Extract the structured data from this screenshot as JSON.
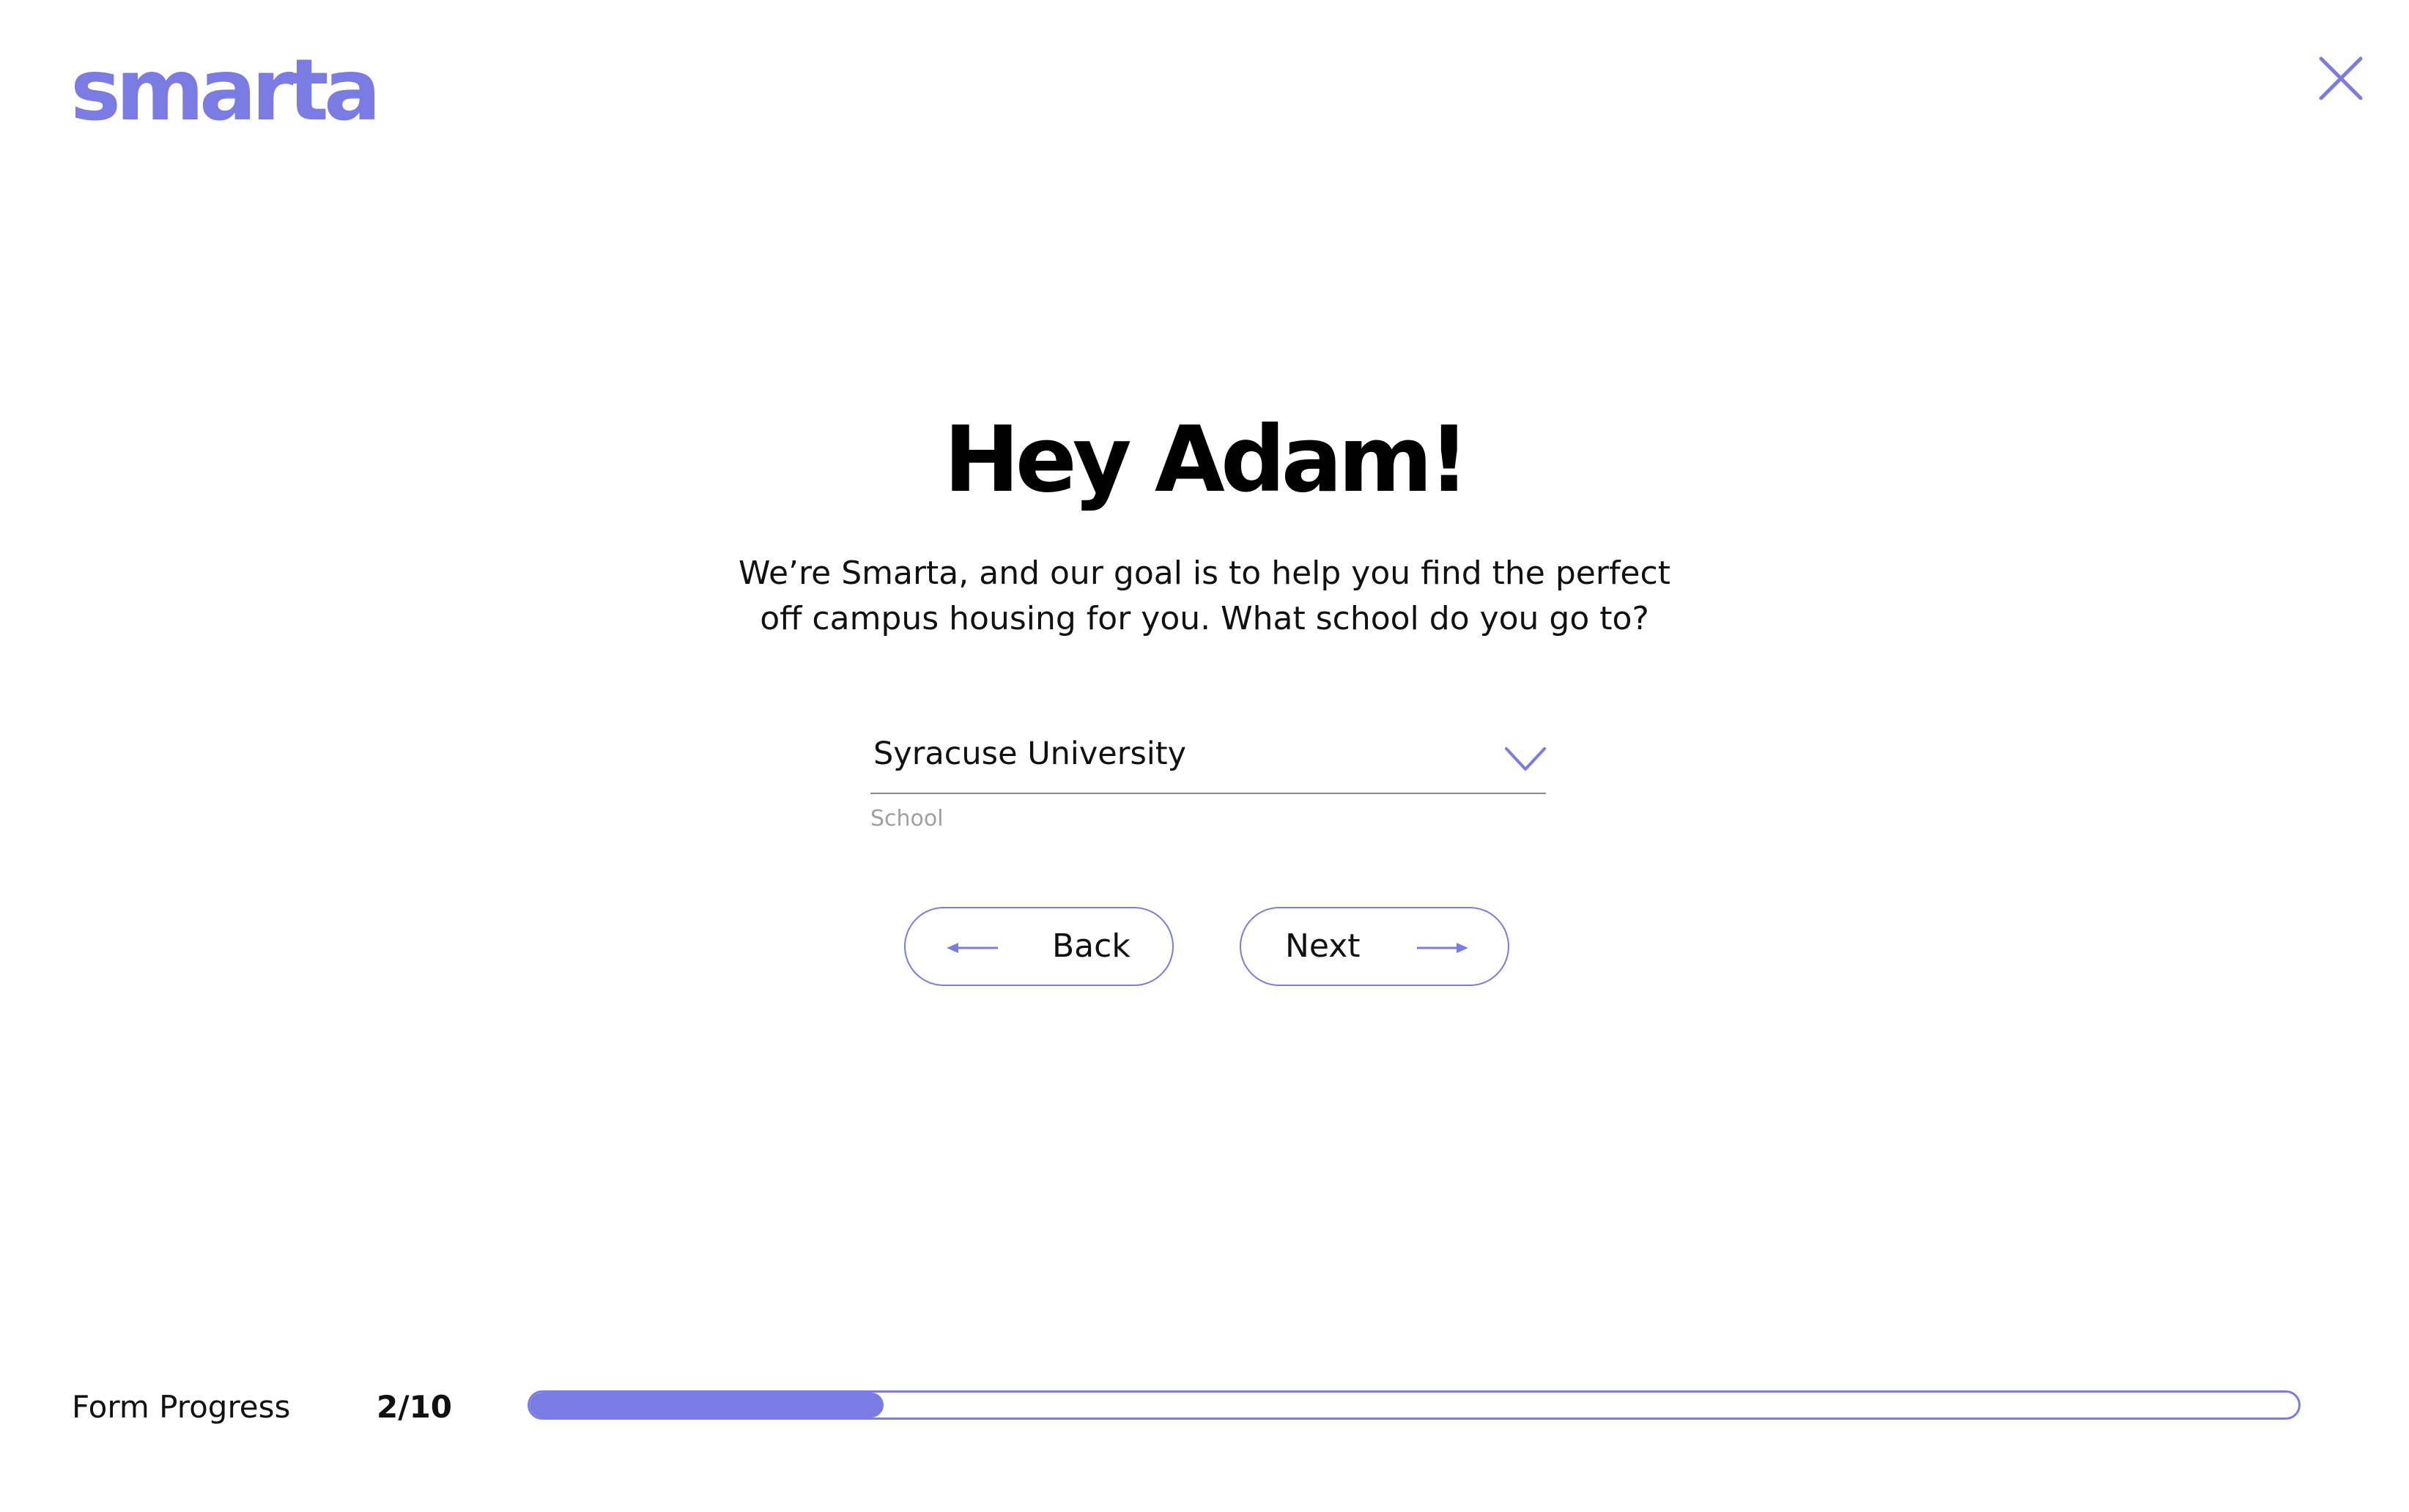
{
  "brand": {
    "logo_text": "smarta",
    "accent_color": "#7a7be3"
  },
  "header": {
    "close_icon": "close-icon"
  },
  "main": {
    "headline": "Hey Adam!",
    "intro": "We’re Smarta, and our goal is to help you find the perfect off campus housing for you. What school do you go to?",
    "school_select": {
      "value": "Syracuse University",
      "caption": "School",
      "icon": "chevron-down-icon"
    },
    "back_button": {
      "label": "Back",
      "icon": "arrow-left-icon"
    },
    "next_button": {
      "label": "Next",
      "icon": "arrow-right-icon"
    }
  },
  "footer": {
    "progress_label": "Form Progress",
    "progress_count": "2/10",
    "progress_fraction": 0.2
  }
}
